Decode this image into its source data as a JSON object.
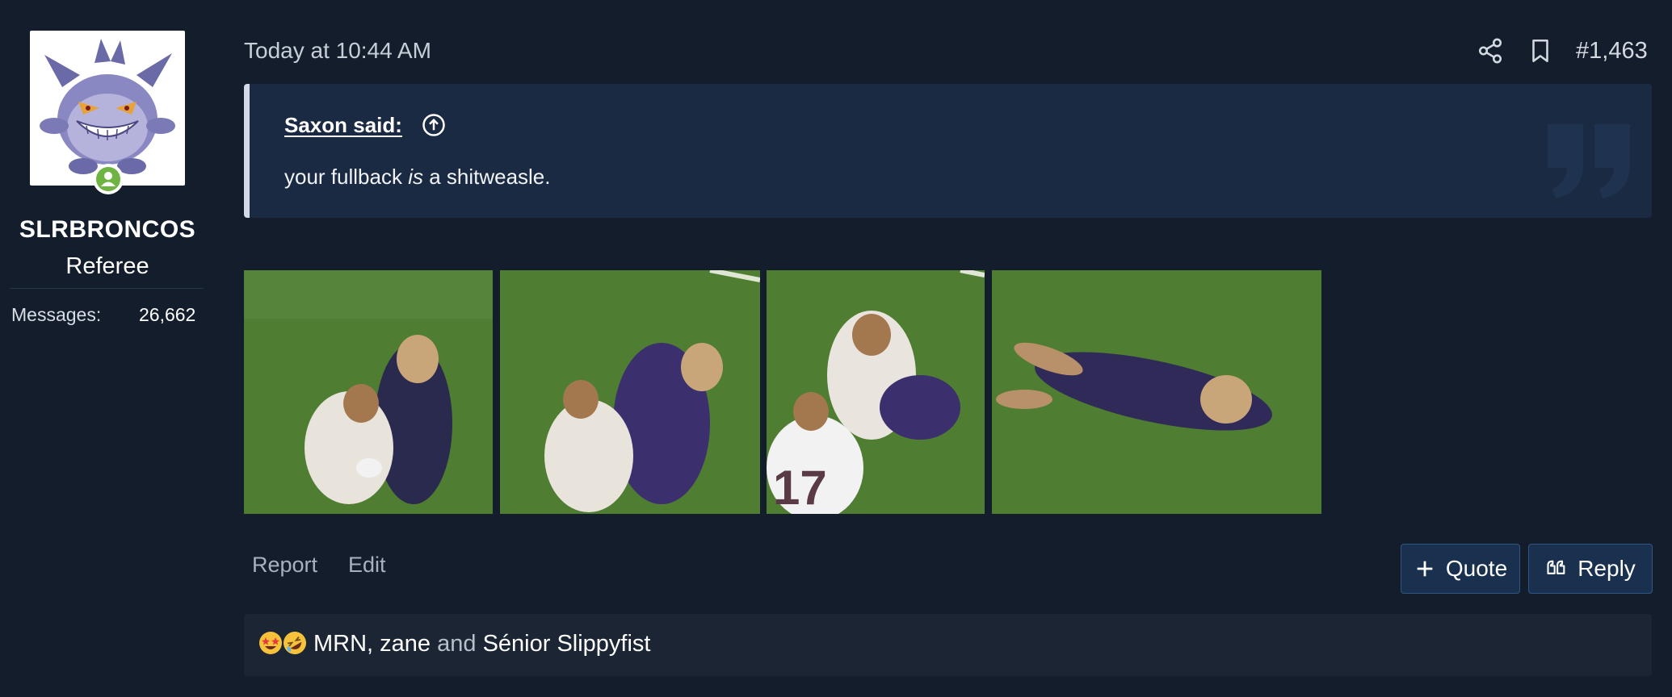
{
  "user": {
    "name": "SLRBRONCOS",
    "title": "Referee",
    "messages_label": "Messages:",
    "messages_value": "26,662",
    "online": true
  },
  "post": {
    "date": "Today at 10:44 AM",
    "number": "#1,463",
    "quote": {
      "author": "Saxon said:",
      "text_before": "your fullback ",
      "text_emphasis": "is",
      "text_after": " a shitweasle."
    },
    "attachments": [
      {
        "kind": "rugby-tackle-frame-1"
      },
      {
        "kind": "rugby-tackle-frame-2"
      },
      {
        "kind": "rugby-tackle-frame-3"
      },
      {
        "kind": "rugby-tackle-frame-4"
      }
    ]
  },
  "actions": {
    "report": "Report",
    "edit": "Edit",
    "quote": "Quote",
    "reply": "Reply"
  },
  "reactions": {
    "emojis": [
      "star-struck-icon",
      "rolling-laughing-icon"
    ],
    "user1": "MRN",
    "sep": ", ",
    "user2": "zane",
    "conj": " and ",
    "user3": "Sénior Slippyfist"
  },
  "colors": {
    "background": "#131d2c",
    "quote_bg": "#1a2a42",
    "button_bg": "#19314f",
    "online": "#6fb342"
  }
}
